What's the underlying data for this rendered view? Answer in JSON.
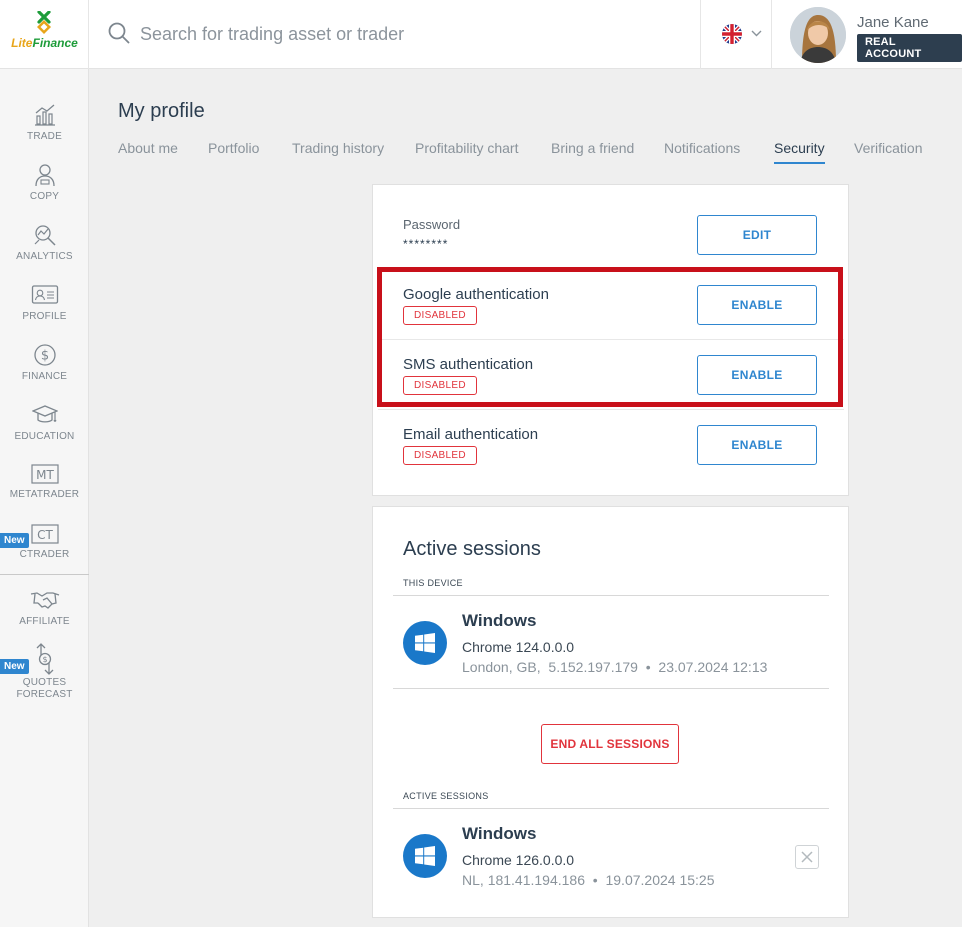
{
  "header": {
    "logo_text_lite": "Lite",
    "logo_text_finance": "Finance",
    "search_placeholder": "Search for trading asset or trader",
    "language_icon": "uk-flag-icon",
    "user_name": "Jane Kane",
    "account_type": "REAL ACCOUNT"
  },
  "sidebar": {
    "items": [
      {
        "label": "TRADE",
        "icon": "chart-icon"
      },
      {
        "label": "COPY",
        "icon": "user-copy-icon"
      },
      {
        "label": "ANALYTICS",
        "icon": "analytics-icon"
      },
      {
        "label": "PROFILE",
        "icon": "id-card-icon"
      },
      {
        "label": "FINANCE",
        "icon": "dollar-icon"
      },
      {
        "label": "EDUCATION",
        "icon": "graduation-cap-icon"
      },
      {
        "label": "METATRADER",
        "icon": "mt-icon",
        "glyph": "MT"
      },
      {
        "label": "CTRADER",
        "icon": "ct-icon",
        "glyph": "CT",
        "badge": "New"
      },
      {
        "label": "AFFILIATE",
        "icon": "handshake-icon"
      },
      {
        "label": "QUOTES",
        "label2": "FORECAST",
        "icon": "quotes-forecast-icon",
        "badge": "New"
      }
    ]
  },
  "page": {
    "title": "My profile",
    "tabs": [
      {
        "label": "About me"
      },
      {
        "label": "Portfolio"
      },
      {
        "label": "Trading history"
      },
      {
        "label": "Profitability chart"
      },
      {
        "label": "Bring a friend"
      },
      {
        "label": "Notifications"
      },
      {
        "label": "Security",
        "active": true
      },
      {
        "label": "Verification"
      }
    ]
  },
  "security": {
    "password_label": "Password",
    "password_value": "********",
    "edit_label": "EDIT",
    "rows": [
      {
        "label": "Google authentication",
        "status": "DISABLED",
        "button": "ENABLE"
      },
      {
        "label": "SMS authentication",
        "status": "DISABLED",
        "button": "ENABLE"
      },
      {
        "label": "Email authentication",
        "status": "DISABLED",
        "button": "ENABLE"
      }
    ]
  },
  "sessions": {
    "title": "Active sessions",
    "this_device_label": "THIS DEVICE",
    "current": {
      "os": "Windows",
      "browser": "Chrome 124.0.0.0",
      "location": "London, GB,",
      "ip": "5.152.197.179",
      "time": "23.07.2024 12:13"
    },
    "end_all_label": "END ALL SESSIONS",
    "active_label": "ACTIVE SESSIONS",
    "others": [
      {
        "os": "Windows",
        "browser": "Chrome 126.0.0.0",
        "location": "NL,",
        "ip": "181.41.194.186",
        "time": "19.07.2024 15:25"
      }
    ],
    "separator": "•"
  },
  "colors": {
    "accent": "#2f86cf",
    "danger": "#e1343c",
    "highlight": "#c8101a",
    "navy": "#2d3e4f"
  }
}
